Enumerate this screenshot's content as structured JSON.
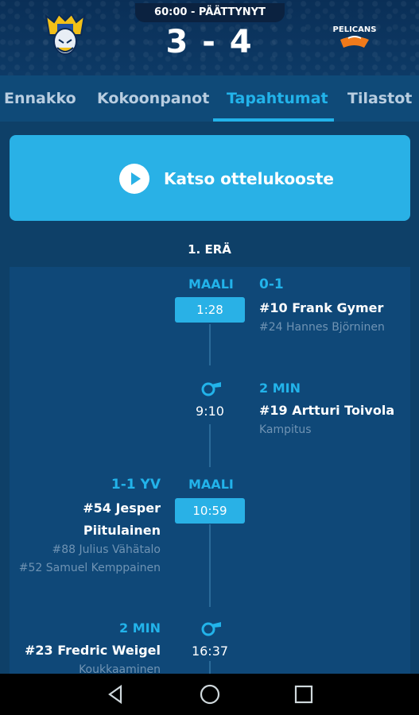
{
  "header": {
    "status": "60:00 - PÄÄTTYNYT",
    "score": "3 - 4",
    "away_logo_text": "PELICANS"
  },
  "tabs": [
    {
      "label": "Ennakko"
    },
    {
      "label": "Kokoonpanot"
    },
    {
      "label": "Tapahtumat",
      "active": true
    },
    {
      "label": "Tilastot"
    }
  ],
  "highlights": {
    "label": "Katso ottelukooste"
  },
  "period": {
    "label": "1. ERÄ"
  },
  "events": [
    {
      "type": "MAALI",
      "time": "1:28",
      "result": "0-1",
      "player": "#10 Frank Gymer",
      "assists": [
        "#24 Hannes Björninen"
      ]
    },
    {
      "time": "9:10",
      "penalty": "2 MIN",
      "player": "#19 Artturi Toivola",
      "reason": "Kampitus"
    },
    {
      "type": "MAALI",
      "time": "10:59",
      "result": "1-1 YV",
      "player_line1": "#54 Jesper",
      "player_line2": "Piitulainen",
      "assists": [
        "#88 Julius Vähätalo",
        "#52 Samuel Kemppainen"
      ]
    },
    {
      "time": "16:37",
      "penalty": "2 MIN",
      "player": "#23 Fredric Weigel",
      "reason": "Koukkaaminen"
    }
  ],
  "colors": {
    "accent": "#22b3ea",
    "background": "#0e4068",
    "button": "#29b1e6"
  }
}
